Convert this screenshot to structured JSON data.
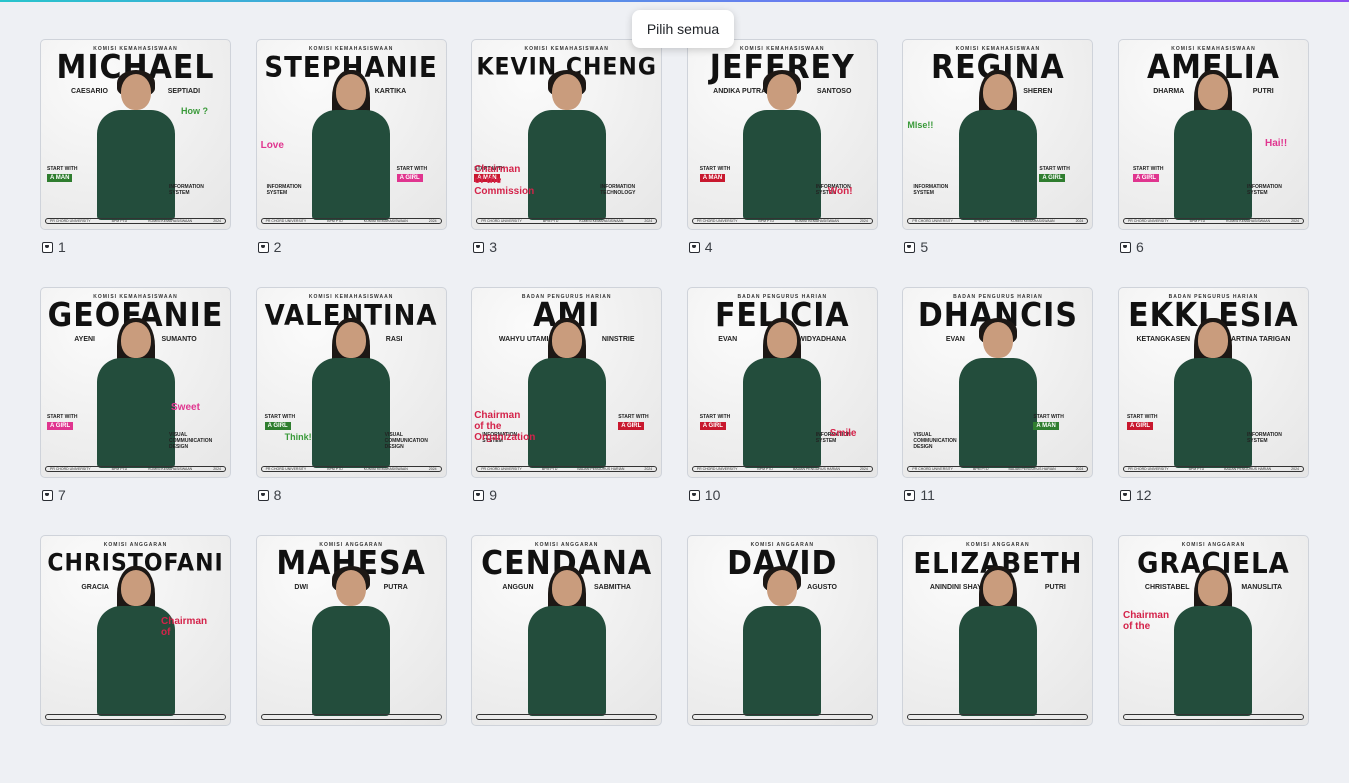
{
  "tooltip": "Pilih semua",
  "cards": [
    {
      "page": "1",
      "org": "Komisi Kemahasiswaan",
      "name": "MICHAEL",
      "size": "",
      "sub": [
        "Caesario",
        "Septiadi"
      ],
      "tag": "A Man",
      "tagColor": "green",
      "tagIntro": "Start with",
      "role": "Information System",
      "doodle": "How ?",
      "doodleColor": "green",
      "hair": "short",
      "footer": [
        "PR CHORD UNIVERSITY",
        "BPM PTD",
        "KOMISI KEMAHASISWAAN",
        "2024"
      ]
    },
    {
      "page": "2",
      "org": "Komisi Kemahasiswaan",
      "name": "STEPHANIE",
      "size": "sm",
      "sub": [
        "",
        "Kartika"
      ],
      "tag": "A Girl",
      "tagColor": "pink",
      "tagIntro": "Start with",
      "role": "Information System",
      "doodle": "Love",
      "doodleColor": "pink",
      "hair": "long",
      "footer": [
        "PR CHORD UNIVERSITY",
        "BPM PTD",
        "KOMISI KEMAHASISWAAN",
        "2024"
      ]
    },
    {
      "page": "3",
      "org": "Komisi Kemahasiswaan",
      "name": "KEVIN CHENG",
      "size": "xs",
      "sub": [
        "",
        ""
      ],
      "tag": "A Man",
      "tagColor": "red",
      "tagIntro": "Start with",
      "role": "Information Technology",
      "doodle": "Chairman of the Commission",
      "doodleColor": "red",
      "hair": "short",
      "footer": [
        "PR CHORD UNIVERSITY",
        "BPM PTD",
        "KOMISI KEMAHASISWAAN",
        "2024"
      ]
    },
    {
      "page": "4",
      "org": "Komisi Kemahasiswaan",
      "name": "JEFFREY",
      "size": "",
      "sub": [
        "Andika Putra",
        "Santoso"
      ],
      "tag": "A Man",
      "tagColor": "red",
      "tagIntro": "Start with",
      "role": "Information System",
      "doodle": "Won!",
      "doodleColor": "red",
      "hair": "short",
      "footer": [
        "PR CHORD UNIVERSITY",
        "BPM PTD",
        "KOMISI KEMAHASISWAAN",
        "2024"
      ]
    },
    {
      "page": "5",
      "org": "Komisi Kemahasiswaan",
      "name": "REGINA",
      "size": "",
      "sub": [
        "",
        "Sheren"
      ],
      "tag": "A Girl",
      "tagColor": "green",
      "tagIntro": "Start with",
      "role": "Information System",
      "doodle": "Mlse!!",
      "doodleColor": "green",
      "hair": "long",
      "footer": [
        "PR CHORD UNIVERSITY",
        "BPM PTD",
        "KOMISI KEMAHASISWAAN",
        "2024"
      ]
    },
    {
      "page": "6",
      "org": "Komisi Kemahasiswaan",
      "name": "AMELIA",
      "size": "",
      "sub": [
        "Dharma",
        "Putri"
      ],
      "tag": "A Girl",
      "tagColor": "pink",
      "tagIntro": "Start with",
      "role": "Information System",
      "doodle": "Hai!!",
      "doodleColor": "pink",
      "hair": "long",
      "footer": [
        "PR CHORD UNIVERSITY",
        "BPM PTD",
        "KOMISI KEMAHASISWAAN",
        "2024"
      ]
    },
    {
      "page": "7",
      "org": "Komisi Kemahasiswaan",
      "name": "GEOFANIE",
      "size": "",
      "sub": [
        "Ayeni",
        "Sumanto"
      ],
      "tag": "A Girl",
      "tagColor": "pink",
      "tagIntro": "Start with",
      "role": "Visual Communication Design",
      "doodle": "Sweet",
      "doodleColor": "pink",
      "hair": "long",
      "footer": [
        "PR CHORD UNIVERSITY",
        "BPM PTD",
        "KOMISI KEMAHASISWAAN",
        "2024"
      ]
    },
    {
      "page": "8",
      "org": "Komisi Kemahasiswaan",
      "name": "VALENTINA",
      "size": "sm",
      "sub": [
        "",
        "Rasi"
      ],
      "tag": "A Girl",
      "tagColor": "green",
      "tagIntro": "Start with",
      "role": "Visual Communication Design",
      "doodle": "Think!",
      "doodleColor": "green",
      "hair": "long",
      "footer": [
        "PR CHORD UNIVERSITY",
        "BPM PTD",
        "KOMISI KEMAHASISWAAN",
        "2024"
      ]
    },
    {
      "page": "9",
      "org": "Badan Pengurus Harian",
      "name": "AMI",
      "size": "",
      "sub": [
        "Wahyu Utami",
        "Ninstrie"
      ],
      "tag": "A Girl",
      "tagColor": "red",
      "tagIntro": "Start with",
      "role": "Information System",
      "doodle": "Chairman of the Organization",
      "doodleColor": "red",
      "hair": "long",
      "footer": [
        "PR CHORD UNIVERSITY",
        "BPM PTD",
        "BADAN PENGURUS HARIAN",
        "2024"
      ]
    },
    {
      "page": "10",
      "org": "Badan Pengurus Harian",
      "name": "FELICIA",
      "size": "",
      "sub": [
        "Evan",
        "Widyadhana"
      ],
      "tag": "A Girl",
      "tagColor": "red",
      "tagIntro": "Start with",
      "role": "Information System",
      "doodle": "Smile",
      "doodleColor": "red",
      "hair": "long",
      "footer": [
        "PR CHORD UNIVERSITY",
        "BPM PTD",
        "BADAN PENGURUS HARIAN",
        "2024"
      ]
    },
    {
      "page": "11",
      "org": "Badan Pengurus Harian",
      "name": "DHANCIS",
      "size": "",
      "sub": [
        "Evan",
        ""
      ],
      "tag": "A Man",
      "tagColor": "green",
      "tagIntro": "Start with",
      "role": "Visual Communication Design",
      "doodle": "",
      "doodleColor": "green",
      "hair": "short",
      "footer": [
        "PR CHORD UNIVERSITY",
        "BPM PTD",
        "BADAN PENGURUS HARIAN",
        "2024"
      ]
    },
    {
      "page": "12",
      "org": "Badan Pengurus Harian",
      "name": "EKKLESIA",
      "size": "",
      "sub": [
        "Ketangkasen",
        "Martina Tarigan"
      ],
      "tag": "A Girl",
      "tagColor": "red",
      "tagIntro": "Start with",
      "role": "Information System",
      "doodle": "",
      "doodleColor": "red",
      "hair": "long",
      "footer": [
        "PR CHORD UNIVERSITY",
        "BPM PTD",
        "BADAN PENGURUS HARIAN",
        "2024"
      ]
    },
    {
      "page": "",
      "org": "Komisi Anggaran",
      "name": "CHRISTOFANI",
      "size": "xs",
      "sub": [
        "Gracia",
        ""
      ],
      "tag": "",
      "tagColor": "",
      "tagIntro": "",
      "role": "",
      "doodle": "Chairman of",
      "doodleColor": "",
      "hair": "long",
      "footer": [
        "",
        "",
        "",
        ""
      ]
    },
    {
      "page": "",
      "org": "Komisi Anggaran",
      "name": "MAHESA",
      "size": "",
      "sub": [
        "Dwi",
        "Putra"
      ],
      "tag": "",
      "tagColor": "",
      "tagIntro": "",
      "role": "",
      "doodle": "",
      "doodleColor": "",
      "hair": "short",
      "footer": [
        "",
        "",
        "",
        ""
      ]
    },
    {
      "page": "",
      "org": "Komisi Anggaran",
      "name": "CENDANA",
      "size": "",
      "sub": [
        "Anggun",
        "Sabmitha"
      ],
      "tag": "",
      "tagColor": "",
      "tagIntro": "",
      "role": "",
      "doodle": "",
      "doodleColor": "",
      "hair": "long",
      "footer": [
        "",
        "",
        "",
        ""
      ]
    },
    {
      "page": "",
      "org": "Komisi Anggaran",
      "name": "DAVID",
      "size": "",
      "sub": [
        "",
        "Agusto"
      ],
      "tag": "",
      "tagColor": "",
      "tagIntro": "",
      "role": "",
      "doodle": "",
      "doodleColor": "",
      "hair": "short",
      "footer": [
        "",
        "",
        "",
        ""
      ]
    },
    {
      "page": "",
      "org": "Komisi Anggaran",
      "name": "ELIZABETH",
      "size": "sm",
      "sub": [
        "Anindini Shayna",
        "Putri"
      ],
      "tag": "",
      "tagColor": "",
      "tagIntro": "",
      "role": "",
      "doodle": "",
      "doodleColor": "",
      "hair": "long",
      "footer": [
        "",
        "",
        "",
        ""
      ]
    },
    {
      "page": "",
      "org": "Komisi Anggaran",
      "name": "GRACIELA",
      "size": "sm",
      "sub": [
        "Christabel",
        "Manuslita"
      ],
      "tag": "",
      "tagColor": "",
      "tagIntro": "",
      "role": "",
      "doodle": "Chairman of the",
      "doodleColor": "red",
      "hair": "long",
      "footer": [
        "",
        "",
        "",
        ""
      ]
    }
  ]
}
